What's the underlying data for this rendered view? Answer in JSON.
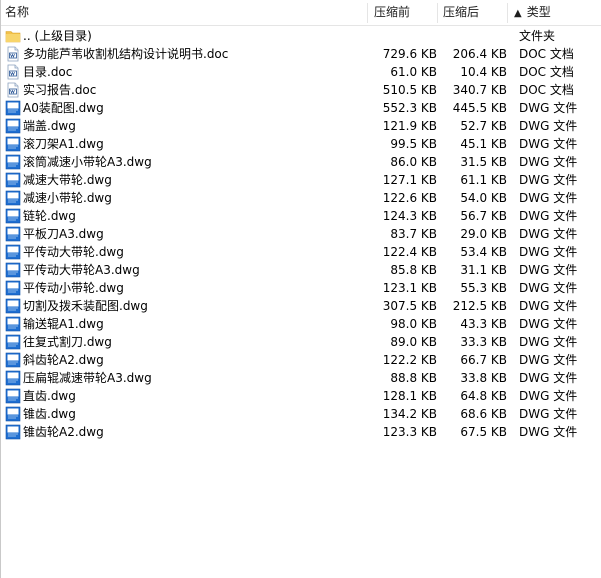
{
  "columns": {
    "name": "名称",
    "original": "压缩前",
    "compressed": "压缩后",
    "type": "类型",
    "sort_indicator": "▲"
  },
  "parent_row": {
    "name": ".. (上级目录)",
    "type": "文件夹",
    "icon": "folder-icon"
  },
  "files": [
    {
      "name": "多功能芦苇收割机结构设计说明书.doc",
      "original": "729.6 KB",
      "compressed": "206.4 KB",
      "type": "DOC 文档",
      "icon": "doc-file-icon"
    },
    {
      "name": "目录.doc",
      "original": "61.0 KB",
      "compressed": "10.4 KB",
      "type": "DOC 文档",
      "icon": "doc-file-icon"
    },
    {
      "name": "实习报告.doc",
      "original": "510.5 KB",
      "compressed": "340.7 KB",
      "type": "DOC 文档",
      "icon": "doc-file-icon"
    },
    {
      "name": "A0装配图.dwg",
      "original": "552.3 KB",
      "compressed": "445.5 KB",
      "type": "DWG 文件",
      "icon": "dwg-file-icon"
    },
    {
      "name": "端盖.dwg",
      "original": "121.9 KB",
      "compressed": "52.7 KB",
      "type": "DWG 文件",
      "icon": "dwg-file-icon"
    },
    {
      "name": "滚刀架A1.dwg",
      "original": "99.5 KB",
      "compressed": "45.1 KB",
      "type": "DWG 文件",
      "icon": "dwg-file-icon"
    },
    {
      "name": "滚筒减速小带轮A3.dwg",
      "original": "86.0 KB",
      "compressed": "31.5 KB",
      "type": "DWG 文件",
      "icon": "dwg-file-icon"
    },
    {
      "name": "减速大带轮.dwg",
      "original": "127.1 KB",
      "compressed": "61.1 KB",
      "type": "DWG 文件",
      "icon": "dwg-file-icon"
    },
    {
      "name": "减速小带轮.dwg",
      "original": "122.6 KB",
      "compressed": "54.0 KB",
      "type": "DWG 文件",
      "icon": "dwg-file-icon"
    },
    {
      "name": "链轮.dwg",
      "original": "124.3 KB",
      "compressed": "56.7 KB",
      "type": "DWG 文件",
      "icon": "dwg-file-icon"
    },
    {
      "name": "平板刀A3.dwg",
      "original": "83.7 KB",
      "compressed": "29.0 KB",
      "type": "DWG 文件",
      "icon": "dwg-file-icon"
    },
    {
      "name": "平传动大带轮.dwg",
      "original": "122.4 KB",
      "compressed": "53.4 KB",
      "type": "DWG 文件",
      "icon": "dwg-file-icon"
    },
    {
      "name": "平传动大带轮A3.dwg",
      "original": "85.8 KB",
      "compressed": "31.1 KB",
      "type": "DWG 文件",
      "icon": "dwg-file-icon"
    },
    {
      "name": "平传动小带轮.dwg",
      "original": "123.1 KB",
      "compressed": "55.3 KB",
      "type": "DWG 文件",
      "icon": "dwg-file-icon"
    },
    {
      "name": "切割及拨禾装配图.dwg",
      "original": "307.5 KB",
      "compressed": "212.5 KB",
      "type": "DWG 文件",
      "icon": "dwg-file-icon"
    },
    {
      "name": "输送辊A1.dwg",
      "original": "98.0 KB",
      "compressed": "43.3 KB",
      "type": "DWG 文件",
      "icon": "dwg-file-icon"
    },
    {
      "name": "往复式割刀.dwg",
      "original": "89.0 KB",
      "compressed": "33.3 KB",
      "type": "DWG 文件",
      "icon": "dwg-file-icon"
    },
    {
      "name": "斜齿轮A2.dwg",
      "original": "122.2 KB",
      "compressed": "66.7 KB",
      "type": "DWG 文件",
      "icon": "dwg-file-icon"
    },
    {
      "name": "压扁辊减速带轮A3.dwg",
      "original": "88.8 KB",
      "compressed": "33.8 KB",
      "type": "DWG 文件",
      "icon": "dwg-file-icon"
    },
    {
      "name": "直齿.dwg",
      "original": "128.1 KB",
      "compressed": "64.8 KB",
      "type": "DWG 文件",
      "icon": "dwg-file-icon"
    },
    {
      "name": "锥齿.dwg",
      "original": "134.2 KB",
      "compressed": "68.6 KB",
      "type": "DWG 文件",
      "icon": "dwg-file-icon"
    },
    {
      "name": "锥齿轮A2.dwg",
      "original": "123.3 KB",
      "compressed": "67.5 KB",
      "type": "DWG 文件",
      "icon": "dwg-file-icon"
    }
  ],
  "colors": {
    "folder": "#f5c748",
    "dwg_blue": "#1f6fd1",
    "doc_border": "#8aa0bd"
  }
}
